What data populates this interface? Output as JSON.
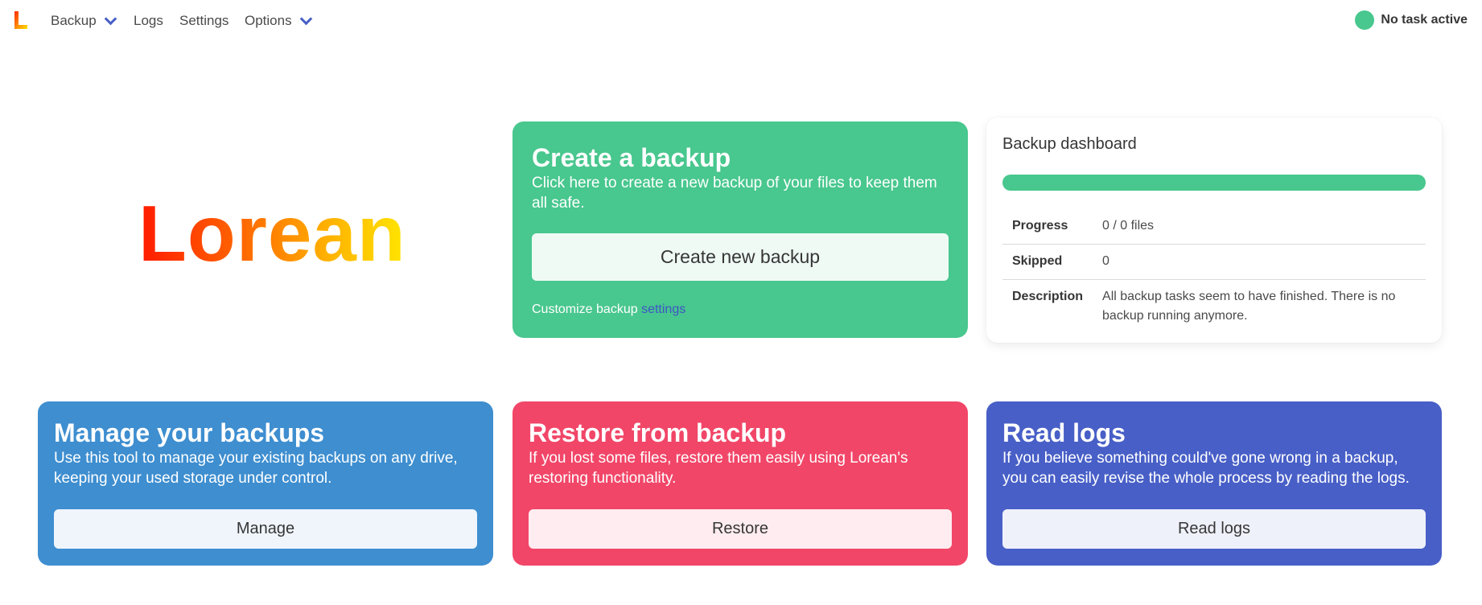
{
  "nav": {
    "items": [
      {
        "label": "Backup",
        "has_dropdown": true
      },
      {
        "label": "Logs",
        "has_dropdown": false
      },
      {
        "label": "Settings",
        "has_dropdown": false
      },
      {
        "label": "Options",
        "has_dropdown": true
      }
    ],
    "status_text": "No task active"
  },
  "brand": {
    "name": "Lorean"
  },
  "create_card": {
    "title": "Create a backup",
    "description": "Click here to create a new backup of your files to keep them all safe.",
    "button_label": "Create new backup",
    "customize_text": "Customize backup",
    "customize_link": "settings"
  },
  "dashboard": {
    "title": "Backup dashboard",
    "progress_fraction": 1.0,
    "rows": [
      {
        "key": "Progress",
        "value": "0 / 0 files"
      },
      {
        "key": "Skipped",
        "value": "0"
      },
      {
        "key": "Description",
        "value": "All backup tasks seem to have finished. There is no backup running anymore."
      }
    ]
  },
  "manage_card": {
    "title": "Manage your backups",
    "description": "Use this tool to manage your existing backups on any drive, keeping your used storage under control.",
    "button_label": "Manage"
  },
  "restore_card": {
    "title": "Restore from backup",
    "description": "If you lost some files, restore them easily using Lorean's restoring functionality.",
    "button_label": "Restore"
  },
  "logs_card": {
    "title": "Read logs",
    "description": "If you believe something could've gone wrong in a backup, you can easily revise the whole process by reading the logs.",
    "button_label": "Read logs"
  },
  "colors": {
    "success": "#48c78e",
    "info": "#3e8ed0",
    "danger": "#f14668",
    "link": "#485fc7"
  },
  "icons": {
    "nav_logo": "lorean-logo-icon",
    "dropdown": "chevron-down-icon",
    "status": "status-dot-icon"
  }
}
